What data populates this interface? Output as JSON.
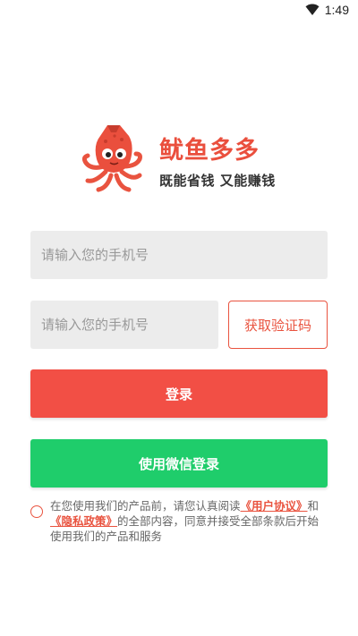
{
  "status_bar": {
    "time": "1:49",
    "wifi_icon": "wifi-icon"
  },
  "brand": {
    "app_name": "鱿鱼多多",
    "slogan": "既能省钱 又能赚钱",
    "logo_icon": "squid-logo-icon"
  },
  "form": {
    "phone_placeholder": "请输入您的手机号",
    "code_placeholder": "请输入您的手机号",
    "get_code_label": "获取验证码",
    "login_label": "登录",
    "wechat_login_label": "使用微信登录"
  },
  "agreement": {
    "text_before": "在您使用我们的产品前，请您认真阅读",
    "user_agreement": "《用户协议》",
    "and": "和",
    "privacy_policy": "《隐私政策》",
    "text_after": "的全部内容，同意并接受全部条款后开始使用我们的产品和服务",
    "checked": false
  },
  "colors": {
    "accent": "#e9533f",
    "login_bg": "#f24f45",
    "wechat_bg": "#1fcd6b",
    "input_bg": "#ececec"
  }
}
